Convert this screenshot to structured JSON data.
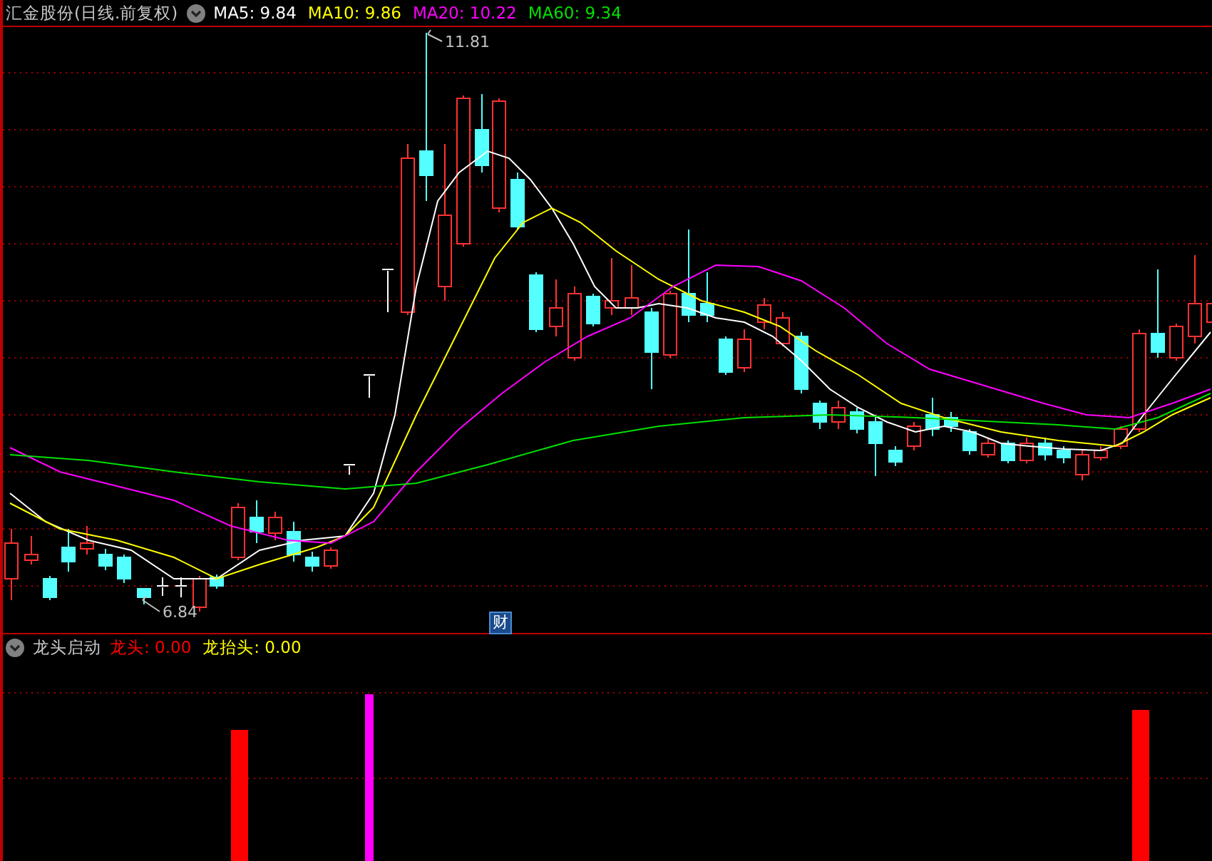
{
  "main_panel": {
    "title": "汇金股份(日线.前复权)",
    "indicators": [
      {
        "label": "MA5:",
        "value": "9.84",
        "color": "#ffffff"
      },
      {
        "label": "MA10:",
        "value": "9.86",
        "color": "#ffff00"
      },
      {
        "label": "MA20:",
        "value": "10.22",
        "color": "#ff00ff"
      },
      {
        "label": "MA60:",
        "value": "9.34",
        "color": "#00e000"
      }
    ],
    "high_label": "11.81",
    "low_label": "6.84",
    "badge": "财"
  },
  "sub_panel": {
    "title": "龙头启动",
    "indicators": [
      {
        "label": "龙头:",
        "value": "0.00",
        "color": "#ff0000"
      },
      {
        "label": "龙抬头:",
        "value": "0.00",
        "color": "#ffff00"
      }
    ]
  }
}
